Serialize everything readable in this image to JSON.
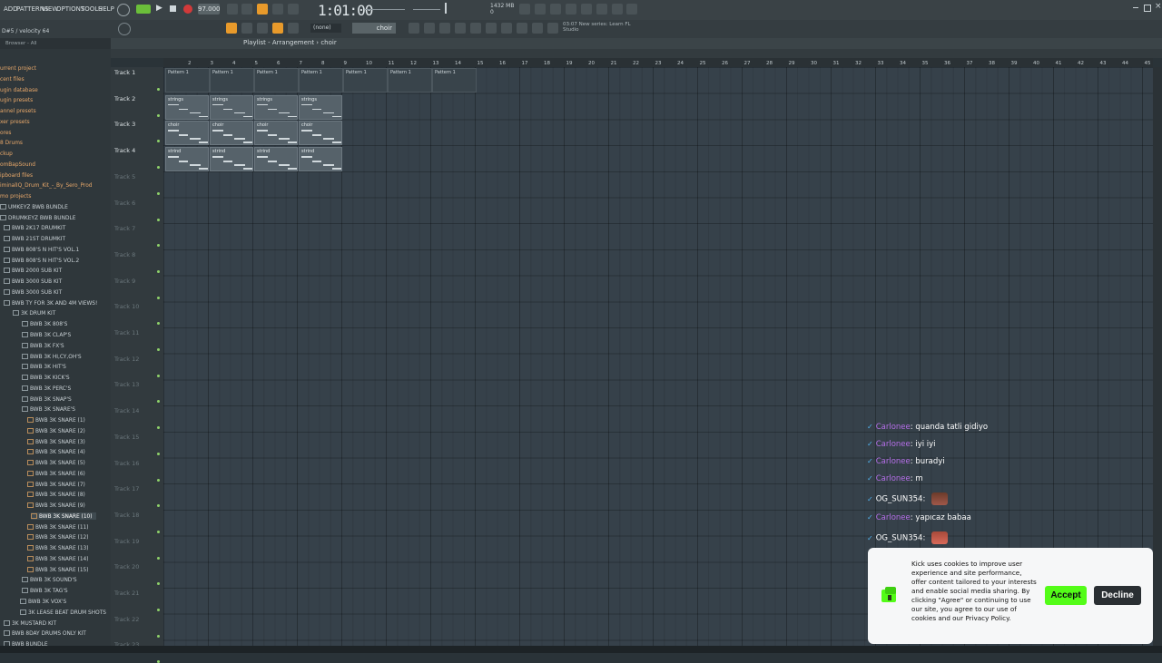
{
  "menu": [
    "ADD",
    "PATTERNS",
    "VIEW",
    "OPTIONS",
    "TOOLS",
    "HELP"
  ],
  "toolbar": {
    "tempo": "97.000",
    "time": "1:01:00",
    "cpu": "1432 MB",
    "cpu_sub": "0",
    "hint": "D#5 / velocity 64",
    "news_1": "New series: Learn FL",
    "news_2": "Studio",
    "news_time": "03:07",
    "pattern_name": "(none)",
    "snap": "choir"
  },
  "browser": {
    "header": "Browser - All",
    "items": [
      {
        "label": "urrent project",
        "kind": "cat"
      },
      {
        "label": "cent files",
        "kind": "cat"
      },
      {
        "label": "ugin database",
        "kind": "cat"
      },
      {
        "label": "ugin presets",
        "kind": "cat"
      },
      {
        "label": "annel presets",
        "kind": "cat"
      },
      {
        "label": "xer presets",
        "kind": "cat"
      },
      {
        "label": "ores",
        "kind": "cat"
      },
      {
        "label": "8 Drums",
        "kind": "cat"
      },
      {
        "label": "ckup",
        "kind": "cat"
      },
      {
        "label": "omBapSound",
        "kind": "cat"
      },
      {
        "label": "ipboard files",
        "kind": "cat"
      },
      {
        "label": "iminalIQ_Drum_Kit_-_By_Sero_Prod",
        "kind": "cat"
      },
      {
        "label": "mo projects",
        "kind": "cat"
      },
      {
        "label": "UMKEYZ BWB BUNDLE",
        "kind": "folder"
      },
      {
        "label": "DRUMKEYZ BWB BUNDLE",
        "kind": "folder"
      },
      {
        "label": "BWB 2K17 DRUMKIT",
        "kind": "folder"
      },
      {
        "label": "BWB 21ST DRUMKIT",
        "kind": "folder"
      },
      {
        "label": "BWB 808'S N HIT'S VOL.1",
        "kind": "folder"
      },
      {
        "label": "BWB 808'S N HIT'S VOL.2",
        "kind": "folder"
      },
      {
        "label": "BWB 2000 SUB KIT",
        "kind": "folder"
      },
      {
        "label": "BWB 3000 SUB KIT",
        "kind": "folder"
      },
      {
        "label": "BWB 3000 SUB KIT",
        "kind": "folder"
      },
      {
        "label": "BWB TY FOR 3K AND 4M VIEWS!",
        "kind": "folder"
      },
      {
        "label": "3K DRUM KIT",
        "kind": "folder"
      },
      {
        "label": "BWB 3K 808'S",
        "kind": "folder"
      },
      {
        "label": "BWB 3K CLAP'S",
        "kind": "folder"
      },
      {
        "label": "BWB 3K FX'S",
        "kind": "folder"
      },
      {
        "label": "BWB 3K HI,CY,OH'S",
        "kind": "folder"
      },
      {
        "label": "BWB 3K HIT'S",
        "kind": "folder"
      },
      {
        "label": "BWB 3K KICK'S",
        "kind": "folder"
      },
      {
        "label": "BWB 3K PERC'S",
        "kind": "folder"
      },
      {
        "label": "BWB 3K SNAP'S",
        "kind": "folder"
      },
      {
        "label": "BWB 3K SNARE'S",
        "kind": "folder"
      },
      {
        "label": "BWB 3K SNARE (1)",
        "kind": "file"
      },
      {
        "label": "BWB 3K SNARE (2)",
        "kind": "file"
      },
      {
        "label": "BWB 3K SNARE (3)",
        "kind": "file"
      },
      {
        "label": "BWB 3K SNARE (4)",
        "kind": "file"
      },
      {
        "label": "BWB 3K SNARE (5)",
        "kind": "file"
      },
      {
        "label": "BWB 3K SNARE (6)",
        "kind": "file"
      },
      {
        "label": "BWB 3K SNARE (7)",
        "kind": "file"
      },
      {
        "label": "BWB 3K SNARE (8)",
        "kind": "file"
      },
      {
        "label": "BWB 3K SNARE (9)",
        "kind": "file"
      },
      {
        "label": "BWB 3K SNARE (10)",
        "kind": "selected"
      },
      {
        "label": "BWB 3K SNARE (11)",
        "kind": "file"
      },
      {
        "label": "BWB 3K SNARE (12)",
        "kind": "file"
      },
      {
        "label": "BWB 3K SNARE (13)",
        "kind": "file"
      },
      {
        "label": "BWB 3K SNARE (14)",
        "kind": "file"
      },
      {
        "label": "BWB 3K SNARE (15)",
        "kind": "file"
      },
      {
        "label": "BWB 3K SOUND'S",
        "kind": "folder"
      },
      {
        "label": "BWB 3K TAG'S",
        "kind": "folder"
      },
      {
        "label": "BWB 3K VOX'S",
        "kind": "folder"
      },
      {
        "label": "3K LEASE BEAT DRUM SHOTS",
        "kind": "folder"
      },
      {
        "label": "3K MUSTARD KIT",
        "kind": "folder"
      },
      {
        "label": "BWB 8DAY DRUMS ONLY KIT",
        "kind": "folder"
      },
      {
        "label": "BWB BUNDLE",
        "kind": "folder"
      }
    ]
  },
  "playlist": {
    "title": "Playlist - Arrangement",
    "pattern": "choir",
    "ruler": [
      "2",
      "3",
      "4",
      "5",
      "6",
      "7",
      "8",
      "9",
      "10",
      "11",
      "12",
      "13",
      "14",
      "15",
      "16",
      "17",
      "18",
      "19",
      "20",
      "21",
      "22",
      "23",
      "24",
      "25",
      "26",
      "27",
      "28",
      "29",
      "30",
      "31",
      "32",
      "33",
      "34",
      "35",
      "36",
      "37",
      "38",
      "39",
      "40",
      "41",
      "42",
      "43",
      "44",
      "45"
    ],
    "tracks": [
      "Track 1",
      "Track 2",
      "Track 3",
      "Track 4",
      "Track 5",
      "Track 6",
      "Track 7",
      "Track 8",
      "Track 9",
      "Track 10",
      "Track 11",
      "Track 12",
      "Track 13",
      "Track 14",
      "Track 15",
      "Track 16",
      "Track 17",
      "Track 18",
      "Track 19",
      "Track 20",
      "Track 21",
      "Track 22",
      "Track 23"
    ],
    "pattern_clip_label": "Pattern 1",
    "clips": [
      {
        "track": 2,
        "label": "strings"
      },
      {
        "track": 3,
        "label": "choir"
      },
      {
        "track": 4,
        "label": "strind"
      }
    ]
  },
  "chat": [
    {
      "user": "Carlonee",
      "msg": "quanda tatli gidiyo",
      "emote": false
    },
    {
      "user": "Carlonee",
      "msg": "iyi iyi",
      "emote": false
    },
    {
      "user": "Carlonee",
      "msg": "buradyi",
      "emote": false
    },
    {
      "user": "Carlonee",
      "msg": "m",
      "emote": false
    },
    {
      "user": "OG_SUN354",
      "msg": "",
      "emote": true
    },
    {
      "user": "Carlonee",
      "msg": "yapıcaz babaa",
      "emote": false
    },
    {
      "user": "OG_SUN354",
      "msg": "",
      "emote": true
    }
  ],
  "cookie": {
    "text": "Kick uses cookies to improve user experience and site performance, offer content tailored to your interests and enable social media sharing. By clicking \"Agree\" or continuing to use our site, you agree to our use of cookies and our Privacy Policy.",
    "accept": "Accept",
    "decline": "Decline"
  },
  "colors": {
    "accent": "#53fc18",
    "chat_name": "#b56ee8",
    "verified": "#53b4f0"
  }
}
